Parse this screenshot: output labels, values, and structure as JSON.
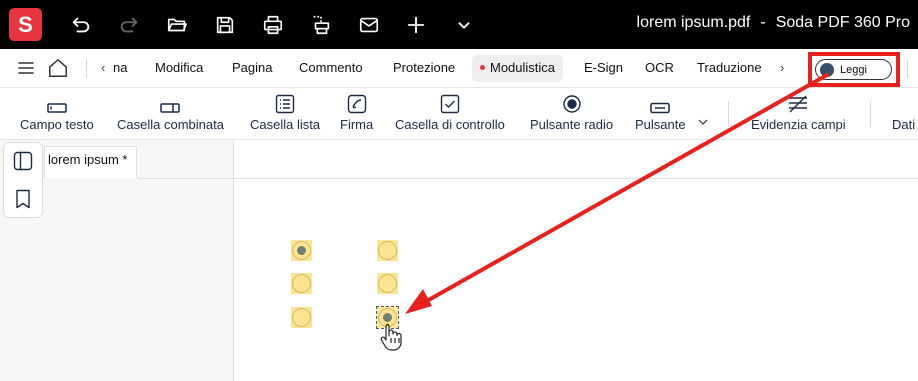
{
  "app": {
    "logo_letter": "S",
    "doc_filename": "lorem ipsum.pdf",
    "separator": "-",
    "app_name": "Soda PDF 360 Pro"
  },
  "titlebar_icons": [
    "undo-icon",
    "redo-icon",
    "open-folder-icon",
    "save-icon",
    "print-icon",
    "scan-icon",
    "mail-icon",
    "add-icon",
    "chevron-down-icon"
  ],
  "nav": {
    "truncated_tab": "na",
    "tabs": [
      "Modifica",
      "Pagina",
      "Commento",
      "Protezione",
      "Modulistica",
      "E-Sign",
      "OCR",
      "Traduzione"
    ],
    "active_tab": "Modulistica",
    "leggi_label": "Leggi"
  },
  "toolbar": {
    "tools": [
      {
        "label": "Campo testo",
        "icon": "text-field-icon"
      },
      {
        "label": "Casella combinata",
        "icon": "combo-box-icon"
      },
      {
        "label": "Casella lista",
        "icon": "list-box-icon"
      },
      {
        "label": "Firma",
        "icon": "signature-icon"
      },
      {
        "label": "Casella di controllo",
        "icon": "checkbox-icon"
      },
      {
        "label": "Pulsante radio",
        "icon": "radio-button-icon"
      },
      {
        "label": "Pulsante",
        "icon": "button-icon"
      },
      {
        "label": "Evidenzia campi",
        "icon": "highlight-fields-icon"
      },
      {
        "label": "Dati",
        "icon": ""
      }
    ]
  },
  "document": {
    "tab_label": "lorem ipsum *"
  },
  "radio_fields": [
    {
      "id": "r1",
      "checked": true
    },
    {
      "id": "r2",
      "checked": false
    },
    {
      "id": "r3",
      "checked": false
    },
    {
      "id": "r4",
      "checked": false
    },
    {
      "id": "r5",
      "checked": false
    },
    {
      "id": "r6",
      "checked": true,
      "selected": true
    }
  ],
  "colors": {
    "brand": "#e8343f",
    "annotation": "#e8211f",
    "field_fill": "#fde492",
    "active_dot": "#e0353f"
  }
}
